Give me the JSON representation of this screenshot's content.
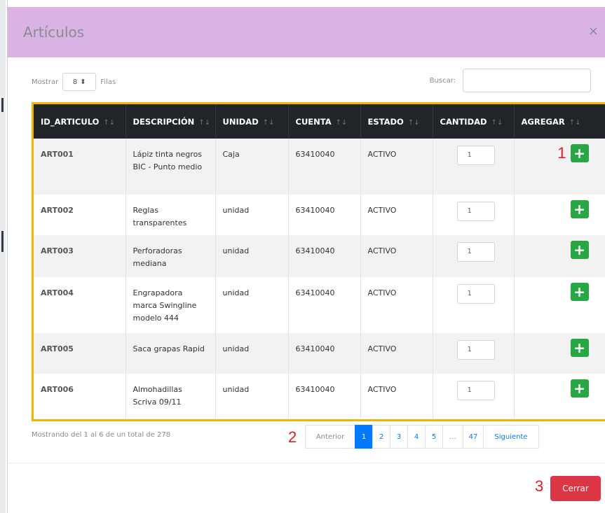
{
  "modal": {
    "title": "Artículos",
    "close_glyph": "×"
  },
  "length_menu": {
    "prefix": "Mostrar",
    "value": "8",
    "suffix": "Filas"
  },
  "search": {
    "label": "Buscar:",
    "value": ""
  },
  "table": {
    "headers": [
      "ID_ARTICULO",
      "DESCRIPCIÓN",
      "UNIDAD",
      "CUENTA",
      "ESTADO",
      "CANTIDAD",
      "AGREGAR"
    ],
    "sort_glyphs": [
      "↑↓",
      "↑↓",
      "↑↓",
      "↑↓",
      "↑↓",
      "↑↓",
      "↑↓"
    ],
    "rows": [
      {
        "id": "ART001",
        "descripcion": "Lápiz tinta negros BIC - Punto medio",
        "unidad": "Caja",
        "cuenta": "63410040",
        "estado": "ACTIVO",
        "cantidad": "1",
        "add": "+"
      },
      {
        "id": "ART002",
        "descripcion": "Reglas transparentes",
        "unidad": "unidad",
        "cuenta": "63410040",
        "estado": "ACTIVO",
        "cantidad": "1",
        "add": "+"
      },
      {
        "id": "ART003",
        "descripcion": "Perforadoras mediana",
        "unidad": "unidad",
        "cuenta": "63410040",
        "estado": "ACTIVO",
        "cantidad": "1",
        "add": "+"
      },
      {
        "id": "ART004",
        "descripcion": "Engrapadora marca Swingline modelo 444",
        "unidad": "unidad",
        "cuenta": "63410040",
        "estado": "ACTIVO",
        "cantidad": "1",
        "add": "+"
      },
      {
        "id": "ART005",
        "descripcion": "Saca grapas Rapid",
        "unidad": "unidad",
        "cuenta": "63410040",
        "estado": "ACTIVO",
        "cantidad": "1",
        "add": "+"
      },
      {
        "id": "ART006",
        "descripcion": "Almohadillas Scriva 09/11",
        "unidad": "unidad",
        "cuenta": "63410040",
        "estado": "ACTIVO",
        "cantidad": "1",
        "add": "+"
      }
    ]
  },
  "info": "Mostrando del 1 al 6 de un total de 278",
  "pagination": {
    "prev": "Anterior",
    "pages": [
      "1",
      "2",
      "3",
      "4",
      "5",
      "…",
      "47"
    ],
    "active": "1",
    "next": "Siguiente"
  },
  "footer": {
    "close_label": "Cerrar"
  },
  "annotations": {
    "one": "1",
    "two": "2",
    "three": "3"
  },
  "colors": {
    "header_bg": "#d9b3e3",
    "table_border": "#f5b400",
    "add_button": "#28a745",
    "close_button": "#dc3545",
    "active_page": "#007bff",
    "annotation": "#e31b23"
  },
  "icons": {
    "sort": "sort-icon",
    "plus": "plus-icon",
    "close": "close-icon",
    "select_arrows": "select-arrows-icon"
  }
}
